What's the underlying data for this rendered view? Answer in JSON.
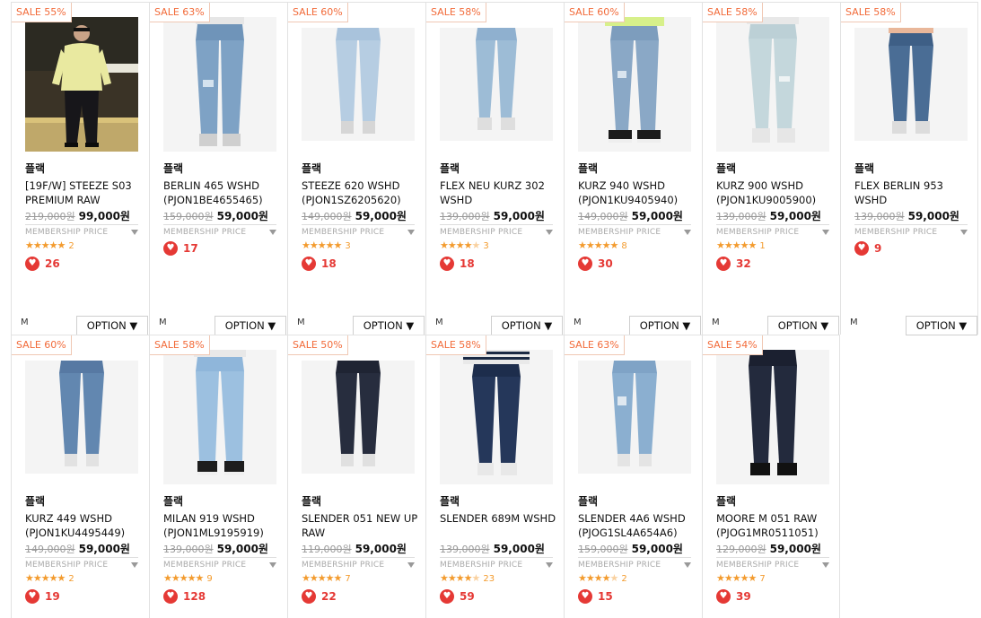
{
  "row1": [
    {
      "sale": "SALE 55%",
      "brand": "플랙",
      "name": "[19F/W] STEEZE S03 PREMIUM RAW",
      "orig_price": "219,000원",
      "price": "99,000원",
      "member": "MEMBERSHIP PRICE",
      "stars": "★★★★★",
      "review_count": "2",
      "likes": "26",
      "size": "M",
      "option": "OPTION ▼"
    },
    {
      "sale": "SALE 63%",
      "brand": "플랙",
      "name": "BERLIN 465 WSHD (PJON1BE4655465)",
      "orig_price": "159,000원",
      "price": "59,000원",
      "member": "MEMBERSHIP PRICE",
      "stars": "",
      "review_count": "",
      "likes": "17",
      "size": "M",
      "option": "OPTION ▼"
    },
    {
      "sale": "SALE 60%",
      "brand": "플랙",
      "name": "STEEZE 620 WSHD (PJON1SZ6205620)",
      "orig_price": "149,000원",
      "price": "59,000원",
      "member": "MEMBERSHIP PRICE",
      "stars": "★★★★★",
      "review_count": "3",
      "likes": "18",
      "size": "M",
      "option": "OPTION ▼"
    },
    {
      "sale": "SALE 58%",
      "brand": "플랙",
      "name": "FLEX NEU KURZ 302 WSHD",
      "orig_price": "139,000원",
      "price": "59,000원",
      "member": "MEMBERSHIP PRICE",
      "stars": "★★★★",
      "review_count": "3",
      "likes": "18",
      "size": "M",
      "option": "OPTION ▼"
    },
    {
      "sale": "SALE 60%",
      "brand": "플랙",
      "name": "KURZ 940 WSHD (PJON1KU9405940)",
      "orig_price": "149,000원",
      "price": "59,000원",
      "member": "MEMBERSHIP PRICE",
      "stars": "★★★★★",
      "review_count": "8",
      "likes": "30",
      "size": "M",
      "option": "OPTION ▼"
    },
    {
      "sale": "SALE 58%",
      "brand": "플랙",
      "name": "KURZ 900 WSHD (PJON1KU9005900)",
      "orig_price": "139,000원",
      "price": "59,000원",
      "member": "MEMBERSHIP PRICE",
      "stars": "★★★★★",
      "review_count": "1",
      "likes": "32",
      "size": "M",
      "option": "OPTION ▼"
    },
    {
      "sale": "SALE 58%",
      "brand": "플랙",
      "name": "FLEX BERLIN 953 WSHD",
      "orig_price": "139,000원",
      "price": "59,000원",
      "member": "MEMBERSHIP PRICE",
      "stars": "",
      "review_count": "",
      "likes": "9",
      "size": "M",
      "option": "OPTION ▼"
    }
  ],
  "row2": [
    {
      "sale": "SALE 60%",
      "brand": "플랙",
      "name": "KURZ 449 WSHD (PJON1KU4495449)",
      "orig_price": "149,000원",
      "price": "59,000원",
      "member": "MEMBERSHIP PRICE",
      "stars": "★★★★★",
      "review_count": "2",
      "likes": "19"
    },
    {
      "sale": "SALE 58%",
      "brand": "플랙",
      "name": "MILAN 919 WSHD (PJON1ML9195919)",
      "orig_price": "139,000원",
      "price": "59,000원",
      "member": "MEMBERSHIP PRICE",
      "stars": "★★★★★",
      "review_count": "9",
      "likes": "128"
    },
    {
      "sale": "SALE 50%",
      "brand": "플랙",
      "name": "SLENDER 051 NEW UP RAW",
      "orig_price": "119,000원",
      "price": "59,000원",
      "member": "MEMBERSHIP PRICE",
      "stars": "★★★★★",
      "review_count": "7",
      "likes": "22"
    },
    {
      "sale": "SALE 58%",
      "brand": "플랙",
      "name": "SLENDER 689M WSHD",
      "orig_price": "139,000원",
      "price": "59,000원",
      "member": "MEMBERSHIP PRICE",
      "stars": "★★★★",
      "review_count": "23",
      "likes": "59"
    },
    {
      "sale": "SALE 63%",
      "brand": "플랙",
      "name": "SLENDER 4A6 WSHD (PJOG1SL4A654A6)",
      "orig_price": "159,000원",
      "price": "59,000원",
      "member": "MEMBERSHIP PRICE",
      "stars": "★★★★",
      "review_count": "2",
      "likes": "15"
    },
    {
      "sale": "SALE 54%",
      "brand": "플랙",
      "name": "MOORE M 051 RAW (PJOG1MR0511051)",
      "orig_price": "129,000원",
      "price": "59,000원",
      "member": "MEMBERSHIP PRICE",
      "stars": "★★★★★",
      "review_count": "7",
      "likes": "39"
    }
  ],
  "icons": {
    "heart": "heart-icon",
    "dropdown": "triangle-down-icon",
    "star": "star-icon"
  },
  "colors": {
    "sale": "#f26b3a",
    "star": "#f39b2e",
    "heart": "#e53935",
    "denim_light": "#9dbcd6",
    "denim_mid": "#5f86b0",
    "denim_dark": "#1f2c45"
  }
}
